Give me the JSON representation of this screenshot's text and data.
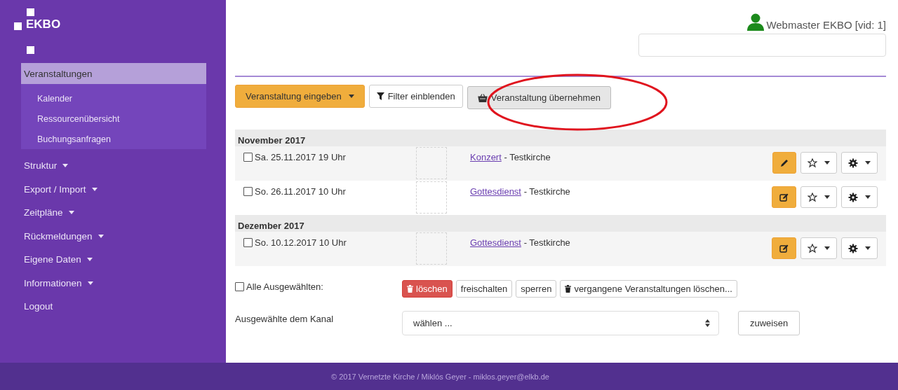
{
  "logo": {
    "text": "EKBO"
  },
  "sidebar": {
    "items": [
      {
        "label": "Veranstaltungen",
        "selected": true,
        "kind": "group",
        "children": [
          {
            "label": "Kalender"
          },
          {
            "label": "Ressourcenübersicht"
          },
          {
            "label": "Buchungsanfragen"
          }
        ]
      },
      {
        "label": "Struktur",
        "selected": false,
        "kind": "dropdown"
      },
      {
        "label": "Export / Import",
        "selected": false,
        "kind": "dropdown"
      },
      {
        "label": "Zeitpläne",
        "selected": false,
        "kind": "dropdown"
      },
      {
        "label": "Rückmeldungen",
        "selected": false,
        "kind": "dropdown"
      },
      {
        "label": "Eigene Daten",
        "selected": false,
        "kind": "dropdown"
      },
      {
        "label": "Informationen",
        "selected": false,
        "kind": "dropdown"
      },
      {
        "label": "Logout",
        "selected": false,
        "kind": "link"
      }
    ]
  },
  "user": {
    "name": "Webmaster EKBO [vid: 1]"
  },
  "toolbar": [
    {
      "label": "Veranstaltung eingeben",
      "kind": "primary-dropdown",
      "circled": false
    },
    {
      "label": "Filter einblenden",
      "kind": "filter",
      "circled": false
    },
    {
      "label": "Veranstaltung übernehmen",
      "kind": "basket",
      "circled": true
    }
  ],
  "groups": [
    {
      "month": "November 2017",
      "events": [
        {
          "date": "Sa. 25.11.2017 19 Uhr",
          "checked": false,
          "title": "Konzert",
          "place": "- Testkirche",
          "kind": "pencil"
        },
        {
          "date": "So. 26.11.2017 10 Uhr",
          "checked": false,
          "title": "Gottesdienst",
          "place": "- Testkirche",
          "kind": "edit"
        }
      ]
    },
    {
      "month": "Dezember 2017",
      "events": [
        {
          "date": "So. 10.12.2017 10 Uhr",
          "checked": false,
          "title": "Gottesdienst",
          "place": "- Testkirche",
          "kind": "edit"
        }
      ]
    }
  ],
  "bulk": {
    "label": "Alle Ausgewählten:",
    "checked": false,
    "buttons": [
      {
        "label": "löschen",
        "kind": "danger"
      },
      {
        "label": "freischalten",
        "kind": "default"
      },
      {
        "label": "sperren",
        "kind": "default"
      },
      {
        "label": "vergangene Veranstaltungen löschen...",
        "kind": "trash"
      }
    ]
  },
  "channel": {
    "label": "Ausgewählte dem Kanal",
    "value": "wählen ...",
    "button": "zuweisen"
  },
  "footer": "© 2017 Vernetzte Kirche / Miklós Geyer - miklos.geyer@elkb.de"
}
